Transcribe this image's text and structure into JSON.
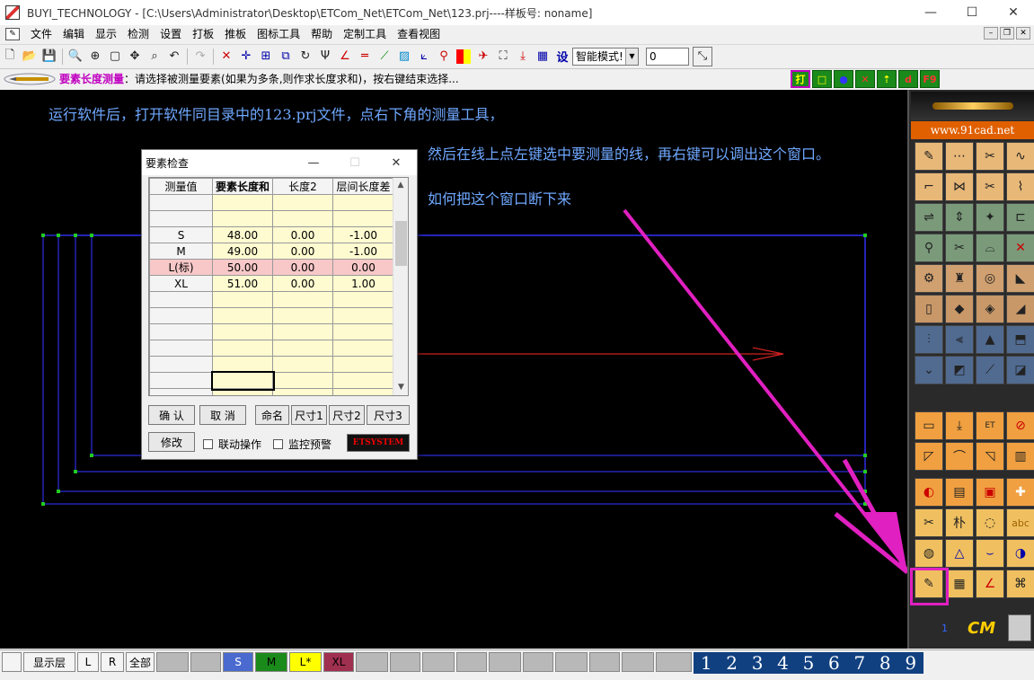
{
  "window": {
    "title": "BUYI_TECHNOLOGY - [C:\\Users\\Administrator\\Desktop\\ETCom_Net\\ETCom_Net\\123.prj----样板号: noname]",
    "minimize": "—",
    "maximize": "☐",
    "close": "✕"
  },
  "menu": {
    "items": [
      "文件",
      "编辑",
      "显示",
      "检测",
      "设置",
      "打板",
      "推板",
      "图标工具",
      "帮助",
      "定制工具",
      "查看视图"
    ]
  },
  "toolbar": {
    "mode_select": "智能模式!",
    "value_field": "0"
  },
  "prompt": {
    "tool_name": "要素长度测量",
    "hint": "：请选择被测量要素(如果为多条,则作求长度求和)，按右键结束选择..."
  },
  "snap_buttons": [
    "打",
    "□",
    "●",
    "✕",
    "⇡",
    "d",
    "F9"
  ],
  "canvas": {
    "note1": "运行软件后，打开软件同目录中的123.prj文件，点右下角的测量工具，",
    "note2": "然后在线上点左键选中要测量的线，再右键可以调出这个窗口。",
    "note3": "如何把这个窗口断下来"
  },
  "palette": {
    "url": "www.91cad.net",
    "layer_num": "1",
    "cm_label": "CM"
  },
  "dialog": {
    "title": "要素检查",
    "columns": [
      "测量值",
      "要素长度和",
      "长度2",
      "层间长度差"
    ],
    "rows": [
      [
        "",
        "",
        "",
        ""
      ],
      [
        "",
        "",
        "",
        ""
      ],
      [
        "S",
        "48.00",
        "0.00",
        "-1.00"
      ],
      [
        "M",
        "49.00",
        "0.00",
        "-1.00"
      ],
      [
        "L(标)",
        "50.00",
        "0.00",
        "0.00"
      ],
      [
        "XL",
        "51.00",
        "0.00",
        "1.00"
      ],
      [
        "",
        "",
        "",
        ""
      ],
      [
        "",
        "",
        "",
        ""
      ],
      [
        "",
        "",
        "",
        ""
      ],
      [
        "",
        "",
        "",
        ""
      ],
      [
        "",
        "",
        "",
        ""
      ],
      [
        "",
        "",
        "",
        ""
      ],
      [
        "",
        "",
        "",
        ""
      ]
    ],
    "highlight_row": 4,
    "buttons": {
      "confirm": "确 认",
      "cancel": "取 消",
      "rename": "命名",
      "size1": "尺寸1",
      "size2": "尺寸2",
      "size3": "尺寸3",
      "modify": "修改"
    },
    "checks": {
      "link": "联动操作",
      "monitor": "监控预警"
    },
    "logo": "ETSYSTEM"
  },
  "bottom": {
    "show_layer": "显示层",
    "l": "L",
    "r": "R",
    "all": "全部",
    "size_s": "S",
    "size_m": "M",
    "size_l": "L*",
    "size_xl": "XL",
    "numbers": [
      "1",
      "2",
      "3",
      "4",
      "5",
      "6",
      "7",
      "8",
      "9"
    ]
  }
}
